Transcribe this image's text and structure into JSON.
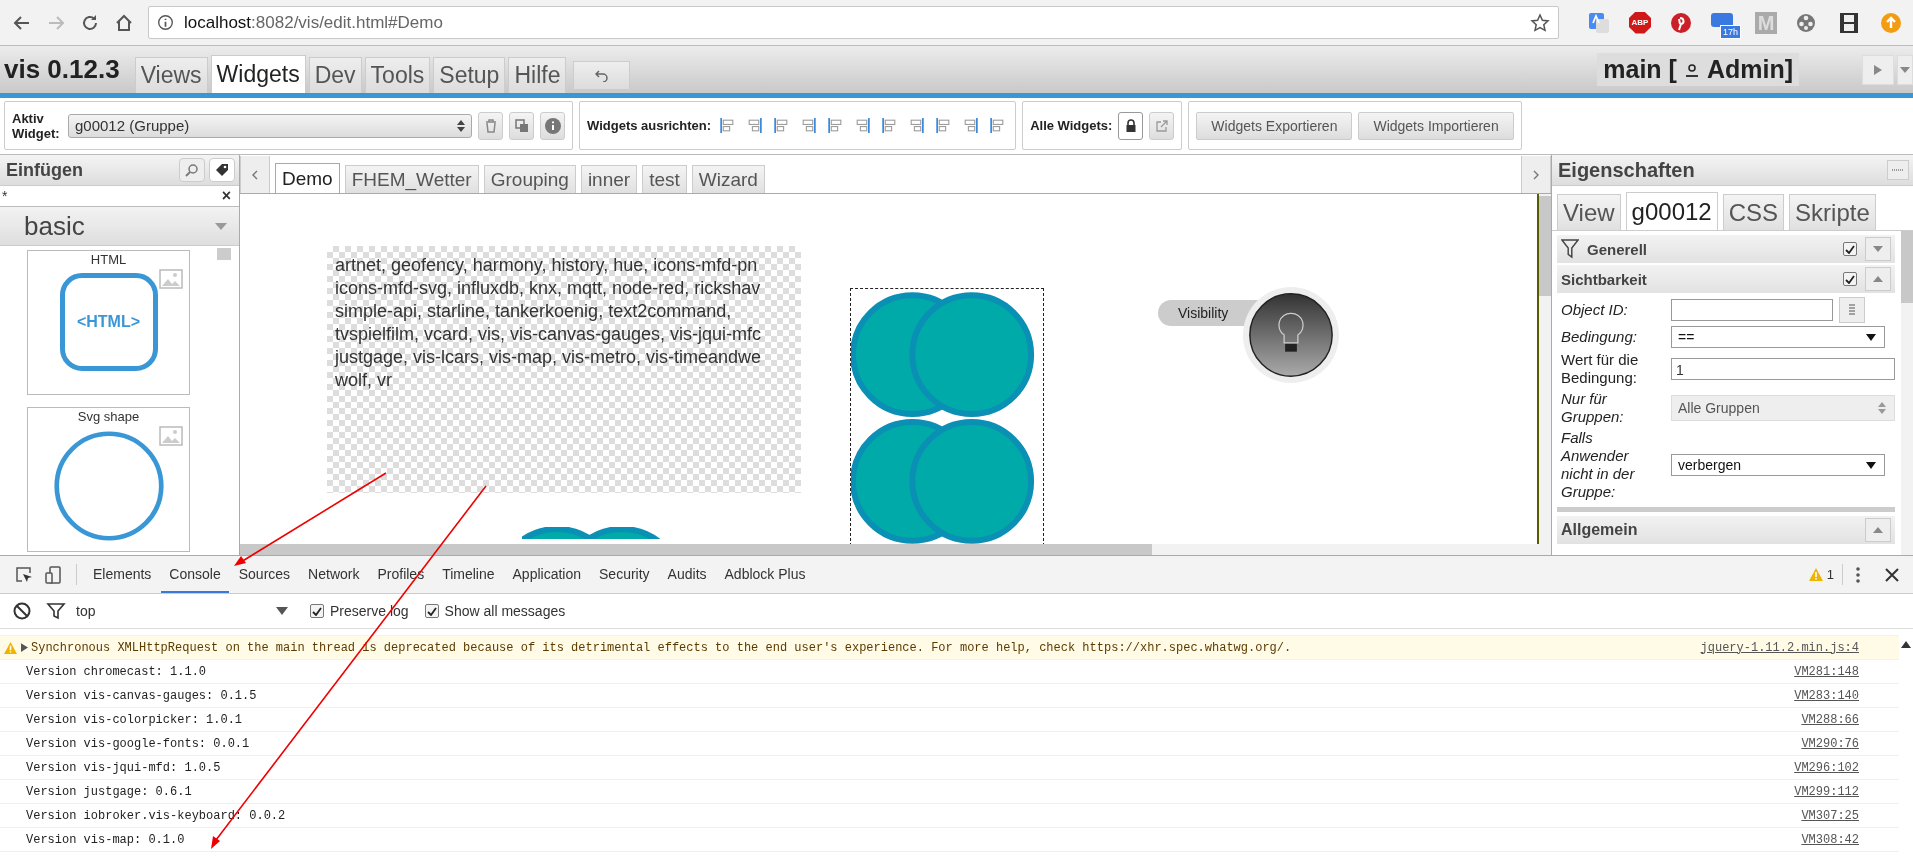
{
  "browser": {
    "url_host": "localhost",
    "url_rest": ":8082/vis/edit.html#Demo",
    "extensions": [
      {
        "kind": "translate"
      },
      {
        "kind": "abp",
        "label": "ABP"
      },
      {
        "kind": "pin"
      },
      {
        "kind": "calendar",
        "label": "17h"
      },
      {
        "kind": "letter",
        "label": "M"
      },
      {
        "kind": "reel"
      },
      {
        "kind": "film"
      },
      {
        "kind": "upload"
      }
    ]
  },
  "app": {
    "title": "vis 0.12.3",
    "menu": [
      {
        "label": "Views",
        "selected": false
      },
      {
        "label": "Widgets",
        "selected": true
      },
      {
        "label": "Dev",
        "selected": false
      },
      {
        "label": "Tools",
        "selected": false
      },
      {
        "label": "Setup",
        "selected": false
      },
      {
        "label": "Hilfe",
        "selected": false
      }
    ],
    "project": "main [",
    "user": "Admin]"
  },
  "widget_bar": {
    "active_label": "Aktiv Widget:",
    "active_value": "g00012 (Gruppe)",
    "align_label": "Widgets ausrichten:",
    "all_label": "Alle Widgets:",
    "export": "Widgets Exportieren",
    "import": "Widgets Importieren"
  },
  "insert_panel": {
    "title": "Einfügen",
    "filter_value": "*",
    "clear": "×",
    "category": "basic",
    "widgets": [
      {
        "name": "HTML",
        "kind": "html",
        "icon_text": "<HTML>"
      },
      {
        "name": "Svg shape",
        "kind": "svg"
      }
    ]
  },
  "view_tabs": [
    {
      "label": "Demo",
      "selected": true
    },
    {
      "label": "FHEM_Wetter",
      "selected": false
    },
    {
      "label": "Grouping",
      "selected": false
    },
    {
      "label": "inner",
      "selected": false
    },
    {
      "label": "test",
      "selected": false
    },
    {
      "label": "Wizard",
      "selected": false
    }
  ],
  "canvas": {
    "text_lines": [
      "artnet, geofency, harmony, history, hue, icons-mfd-pn",
      "icons-mfd-svg, influxdb, knx, mqtt, node-red, rickshav",
      "simple-api, starline, tankerkoenig, text2command,",
      "tvspielfilm, vcard, vis, vis-canvas-gauges, vis-jqui-mfc",
      "justgage, vis-lcars, vis-map, vis-metro, vis-timeandwe",
      "wolf, vr"
    ],
    "visibility_label": "Visibility"
  },
  "properties": {
    "title": "Eigenschaften",
    "tabs": [
      {
        "label": "View",
        "selected": false
      },
      {
        "label": "g00012",
        "selected": true
      },
      {
        "label": "CSS",
        "selected": false
      },
      {
        "label": "Skripte",
        "selected": false
      }
    ],
    "groups": [
      {
        "title": "Generell",
        "checked": true,
        "expanded": false
      },
      {
        "title": "Sichtbarkeit",
        "checked": true,
        "expanded": true
      }
    ],
    "fields": [
      {
        "label": "Object ID:",
        "kind": "picker",
        "italic": true
      },
      {
        "label": "Bedingung:",
        "kind": "select",
        "value": "==",
        "italic": true,
        "disabled": false
      },
      {
        "label": "Wert für die Bedingung:",
        "kind": "input",
        "value": "1",
        "italic": false
      },
      {
        "label": "Nur für Gruppen:",
        "kind": "select",
        "value": "Alle Gruppen",
        "italic": true,
        "disabled": true
      },
      {
        "label": "Falls Anwender nicht in der Gruppe:",
        "kind": "select",
        "value": "verbergen",
        "italic": true,
        "disabled": false
      }
    ],
    "next_group": {
      "title": "Allgemein",
      "expanded": true
    }
  },
  "devtools": {
    "tabs": [
      {
        "label": "Elements",
        "selected": false
      },
      {
        "label": "Console",
        "selected": true
      },
      {
        "label": "Sources",
        "selected": false
      },
      {
        "label": "Network",
        "selected": false
      },
      {
        "label": "Profiles",
        "selected": false
      },
      {
        "label": "Timeline",
        "selected": false
      },
      {
        "label": "Application",
        "selected": false
      },
      {
        "label": "Security",
        "selected": false
      },
      {
        "label": "Audits",
        "selected": false
      },
      {
        "label": "Adblock Plus",
        "selected": false
      }
    ],
    "warning_count": "1",
    "context": "top",
    "options": [
      {
        "label": "Preserve log",
        "checked": true
      },
      {
        "label": "Show all messages",
        "checked": true
      }
    ],
    "messages": [
      {
        "kind": "warning",
        "text": "Synchronous XMLHttpRequest on the main thread is deprecated because of its detrimental effects to the end user's experience. For more help, check https://xhr.spec.whatwg.org/.",
        "source": "jquery-1.11.2.min.js:4"
      },
      {
        "kind": "log",
        "text": "Version chromecast: 1.1.0",
        "source": "VM281:148"
      },
      {
        "kind": "log",
        "text": "Version vis-canvas-gauges: 0.1.5",
        "source": "VM283:140"
      },
      {
        "kind": "log",
        "text": "Version vis-colorpicker: 1.0.1",
        "source": "VM288:66"
      },
      {
        "kind": "log",
        "text": "Version vis-google-fonts: 0.0.1",
        "source": "VM290:76"
      },
      {
        "kind": "log",
        "text": "Version vis-jqui-mfd: 1.0.5",
        "source": "VM296:102"
      },
      {
        "kind": "log",
        "text": "Version justgage: 0.6.1",
        "source": "VM299:112"
      },
      {
        "kind": "log",
        "text": "Version iobroker.vis-keyboard: 0.0.2",
        "source": "VM307:25"
      },
      {
        "kind": "log",
        "text": "Version vis-map: 0.1.0",
        "source": "VM308:42"
      }
    ]
  }
}
